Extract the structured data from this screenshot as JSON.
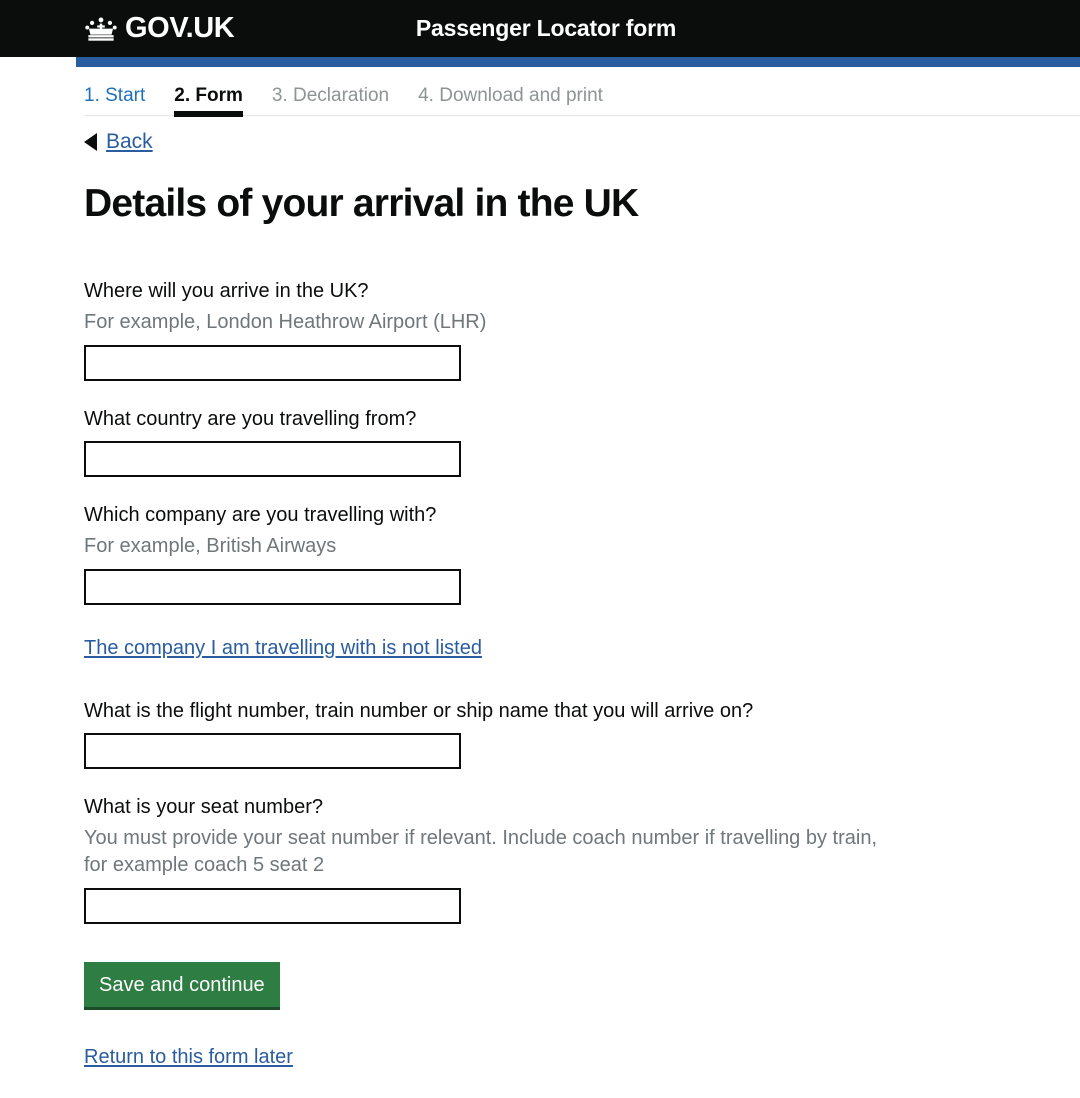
{
  "header": {
    "brand": "GOV.UK",
    "crown_icon": "crown-icon",
    "service_name": "Passenger Locator form",
    "accent_color": "#2a5d9f",
    "background_color": "#0b0c0c"
  },
  "steps": [
    {
      "label": "1. Start",
      "state": "done"
    },
    {
      "label": "2. Form",
      "state": "current"
    },
    {
      "label": "3. Declaration",
      "state": "upcoming"
    },
    {
      "label": "4. Download and print",
      "state": "upcoming"
    }
  ],
  "back": {
    "label": "Back",
    "icon": "arrow-left-icon"
  },
  "page_title": "Details of your arrival in the UK",
  "fields": [
    {
      "label": "Where will you arrive in the UK?",
      "hint": "For example, London Heathrow Airport (LHR)",
      "value": "",
      "placeholder": ""
    },
    {
      "label": "What country are you travelling from?",
      "hint": "",
      "value": "",
      "placeholder": ""
    },
    {
      "label": "Which company are you travelling with?",
      "hint": "For example, British Airways",
      "value": "",
      "placeholder": ""
    },
    {
      "label": "What is the flight number, train number or ship name that you will arrive on?",
      "hint": "",
      "value": "",
      "placeholder": ""
    },
    {
      "label": "What is your seat number?",
      "hint": "You must provide your seat number if relevant. Include coach number if travelling by train, for example coach 5 seat 2",
      "value": "",
      "placeholder": ""
    }
  ],
  "links": {
    "company_not_listed": "The company I am travelling with is not listed",
    "return_later": "Return to this form later"
  },
  "actions": {
    "submit": "Save and continue",
    "submit_color": "#2e7d43"
  }
}
